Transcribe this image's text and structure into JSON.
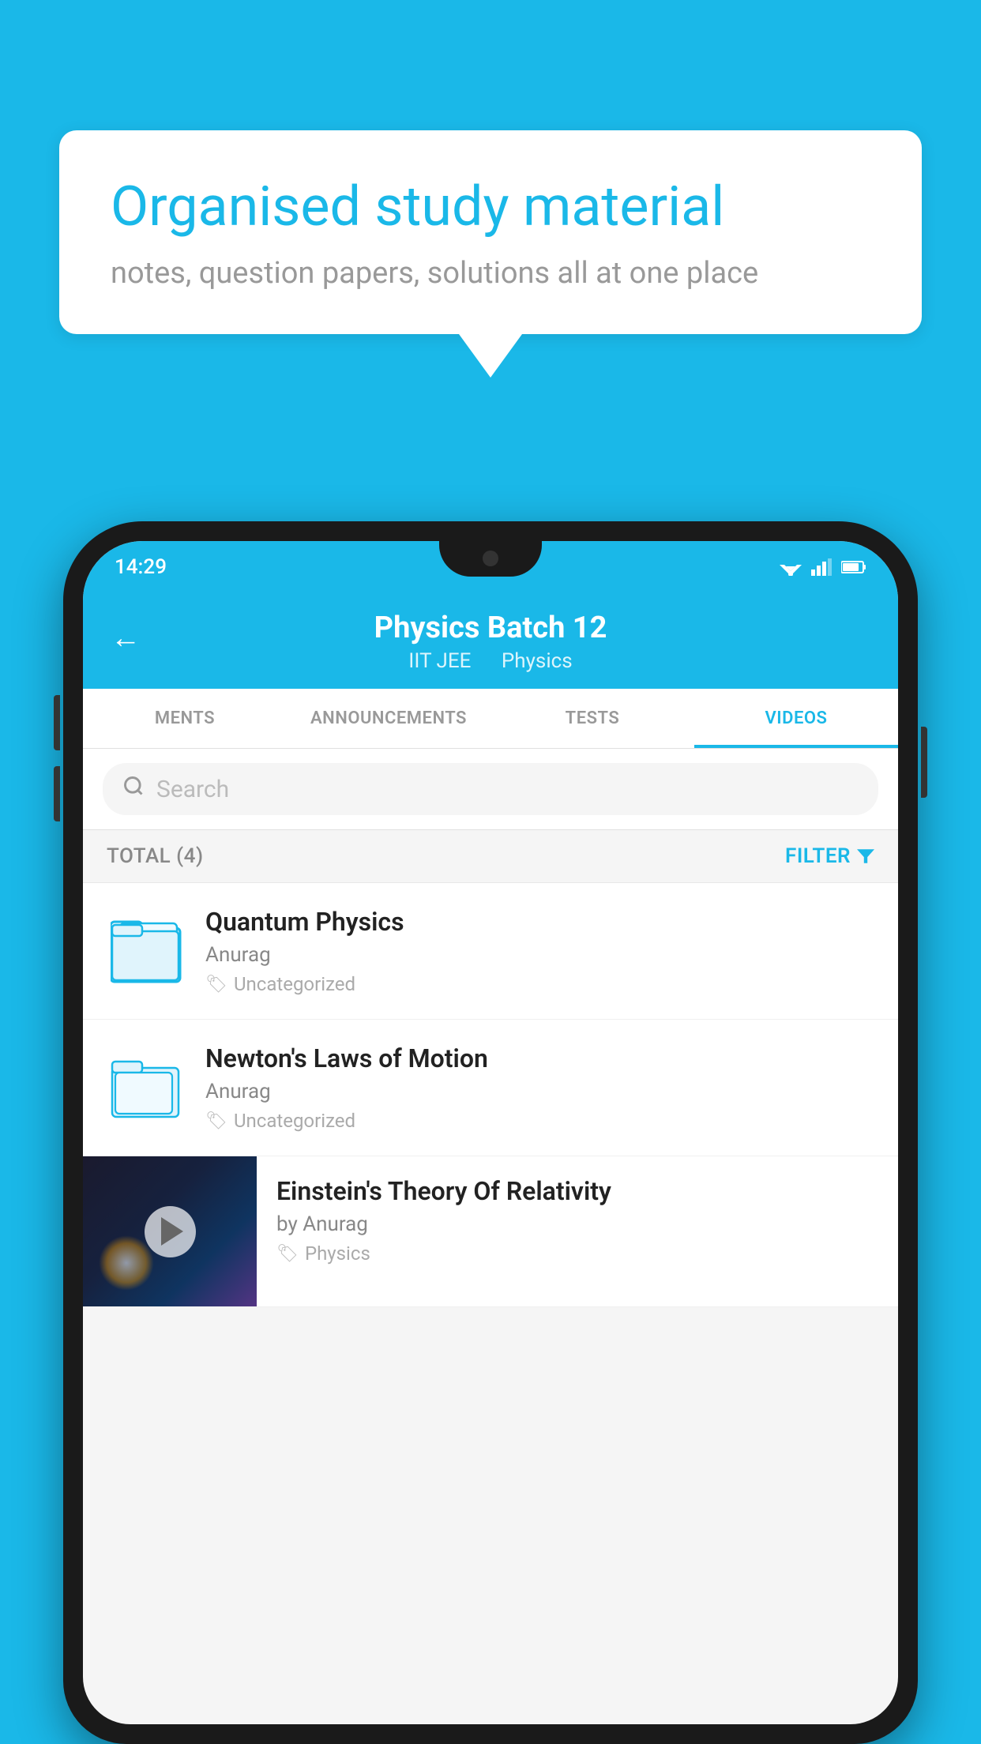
{
  "background_color": "#1ab8e8",
  "speech_bubble": {
    "title": "Organised study material",
    "subtitle": "notes, question papers, solutions all at one place"
  },
  "status_bar": {
    "time": "14:29"
  },
  "app_header": {
    "back_label": "←",
    "title": "Physics Batch 12",
    "subtitle_part1": "IIT JEE",
    "subtitle_part2": "Physics"
  },
  "tabs": [
    {
      "label": "MENTS",
      "active": false
    },
    {
      "label": "ANNOUNCEMENTS",
      "active": false
    },
    {
      "label": "TESTS",
      "active": false
    },
    {
      "label": "VIDEOS",
      "active": true
    }
  ],
  "search": {
    "placeholder": "Search"
  },
  "filter_row": {
    "total_label": "TOTAL (4)",
    "filter_label": "FILTER"
  },
  "videos": [
    {
      "title": "Quantum Physics",
      "author": "Anurag",
      "tag": "Uncategorized",
      "has_thumb": false
    },
    {
      "title": "Newton's Laws of Motion",
      "author": "Anurag",
      "tag": "Uncategorized",
      "has_thumb": false
    },
    {
      "title": "Einstein's Theory Of Relativity",
      "author": "by Anurag",
      "tag": "Physics",
      "has_thumb": true
    }
  ]
}
